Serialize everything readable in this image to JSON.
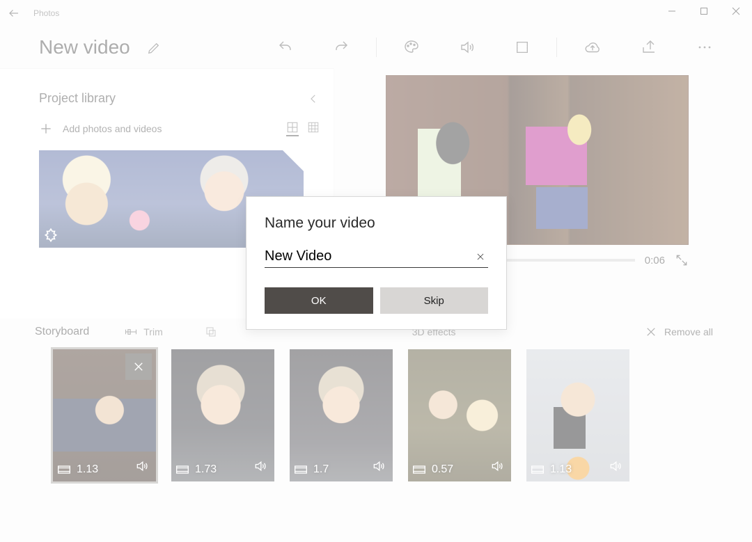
{
  "titlebar": {
    "app_name": "Photos"
  },
  "header": {
    "title": "New video"
  },
  "library": {
    "title": "Project library",
    "add_label": "Add photos and videos"
  },
  "preview": {
    "timecode": "0:06"
  },
  "storyboard": {
    "title": "Storyboard",
    "trim_label": "Trim",
    "effects_label": "3D effects",
    "remove_all_label": "Remove all",
    "clips": [
      {
        "duration": "1.13"
      },
      {
        "duration": "1.73"
      },
      {
        "duration": "1.7"
      },
      {
        "duration": "0.57"
      },
      {
        "duration": "1.13"
      }
    ]
  },
  "dialog": {
    "title": "Name your video",
    "input_value": "New Video",
    "ok_label": "OK",
    "skip_label": "Skip"
  }
}
